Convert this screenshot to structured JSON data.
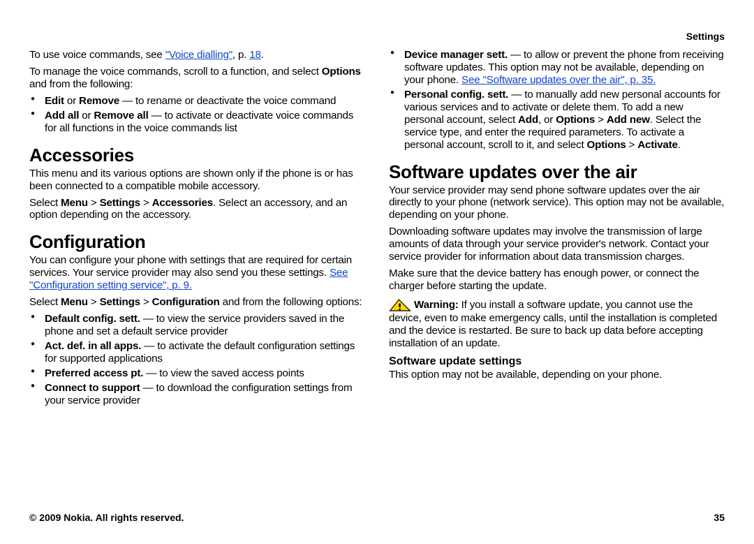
{
  "header": {
    "section": "Settings"
  },
  "footer": {
    "copyright": "© 2009 Nokia. All rights reserved.",
    "page": "35"
  },
  "left": {
    "p1a": "To use voice commands, see ",
    "p1link": "\"Voice dialling\"",
    "p1b": ", p. ",
    "p1page": "18",
    "p1c": ".",
    "p2a": "To manage the voice commands, scroll to a function, and select ",
    "p2b": "Options",
    "p2c": " and from the following:",
    "bul1": {
      "b1": "Edit",
      "mid1": " or ",
      "b2": "Remove",
      "rest": " — to rename or deactivate the voice command"
    },
    "bul2": {
      "b1": "Add all",
      "mid1": " or ",
      "b2": "Remove all",
      "rest": " — to activate or deactivate voice commands for all functions in the voice commands list"
    },
    "h_acc": "Accessories",
    "acc_p1": "This menu and its various options are shown only if the phone is or has been connected to a compatible mobile accessory.",
    "acc_p2a": "Select ",
    "acc_p2b": "Menu",
    "acc_gt1": " > ",
    "acc_p2c": "Settings",
    "acc_gt2": " > ",
    "acc_p2d": "Accessories",
    "acc_p2e": ". Select an accessory, and an option depending on the accessory.",
    "h_conf": "Configuration",
    "conf_p1a": "You can configure your phone with settings that are required for certain services. Your service provider may also send you these settings. ",
    "conf_link": "See \"Configuration setting service\", p. 9.",
    "conf_p2a": "Select ",
    "conf_p2b": "Menu",
    "conf_gt1": " > ",
    "conf_p2c": "Settings",
    "conf_gt2": " > ",
    "conf_p2d": "Configuration",
    "conf_p2e": " and from the following options:",
    "cbul1": {
      "b": "Default config. sett.",
      "rest": "  — to view the service providers saved in the phone and set a default service provider"
    },
    "cbul2": {
      "b": "Act. def. in all apps.",
      "rest": "  — to activate the default configuration settings for supported applications"
    },
    "cbul3": {
      "b": "Preferred access pt.",
      "rest": "  — to view the saved access points"
    },
    "cbul4": {
      "b": "Connect to support",
      "rest": "  — to download the configuration settings from your service provider"
    }
  },
  "right": {
    "rbul1": {
      "b": "Device manager sett.",
      "rest1": "  — to allow or prevent the phone from receiving software updates. This option may not be available, depending on your phone. ",
      "link": "See \"Software updates over the air\", p. 35."
    },
    "rbul2": {
      "b": "Personal config. sett.",
      "rest1": "  — to manually add new personal accounts for various services and to activate or delete them. To add a new personal account, select ",
      "b2": "Add",
      "rest2": ", or ",
      "b3": "Options",
      "gt": " > ",
      "b4": "Add new",
      "rest3": ". Select the service type, and enter the required parameters. To activate a personal account, scroll to it, and select ",
      "b5": "Options",
      "gt2": " > ",
      "b6": "Activate",
      "rest4": "."
    },
    "h_sw": "Software updates over the air",
    "sw_p1": "Your service provider may send phone software updates over the air directly to your phone (network service). This option may not be available, depending on your phone.",
    "sw_p2": "Downloading software updates may involve the transmission of large amounts of data through your service provider's network. Contact your service provider for information about data transmission charges.",
    "sw_p3": "Make sure that the device battery has enough power, or connect the charger before starting the update.",
    "warn_label": "Warning:",
    "warn_text": "  If you install a software update, you cannot use the device, even to make emergency calls, until the installation is completed and the device is restarted. Be sure to back up data before accepting installation of an update.",
    "h_sus": "Software update settings",
    "sus_p": "This option may not be available, depending on your phone."
  }
}
